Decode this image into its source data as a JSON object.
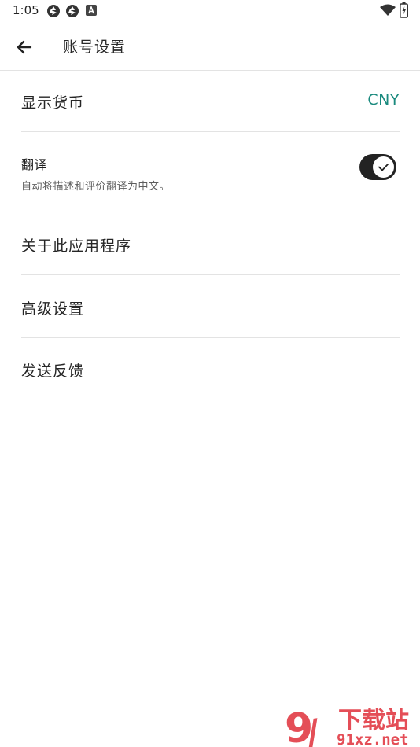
{
  "status_bar": {
    "time": "1:05",
    "icons": [
      "aperture-icon",
      "aperture-icon",
      "font-a-icon",
      "wifi-icon",
      "battery-icon"
    ]
  },
  "header": {
    "title": "账号设置",
    "back_icon": "arrow-left-icon"
  },
  "settings": {
    "currency": {
      "label": "显示货币",
      "value": "CNY"
    },
    "translate": {
      "title": "翻译",
      "description": "自动将描述和评价翻译为中文。",
      "enabled": true
    },
    "about": {
      "label": "关于此应用程序"
    },
    "advanced": {
      "label": "高级设置"
    },
    "feedback": {
      "label": "发送反馈"
    }
  },
  "watermark": {
    "text": "下载站",
    "site": "91xz.net"
  },
  "colors": {
    "accent": "#1a8a7e",
    "toggle_track": "#232323",
    "divider": "#e3e3e3",
    "watermark": "#e0303a"
  }
}
